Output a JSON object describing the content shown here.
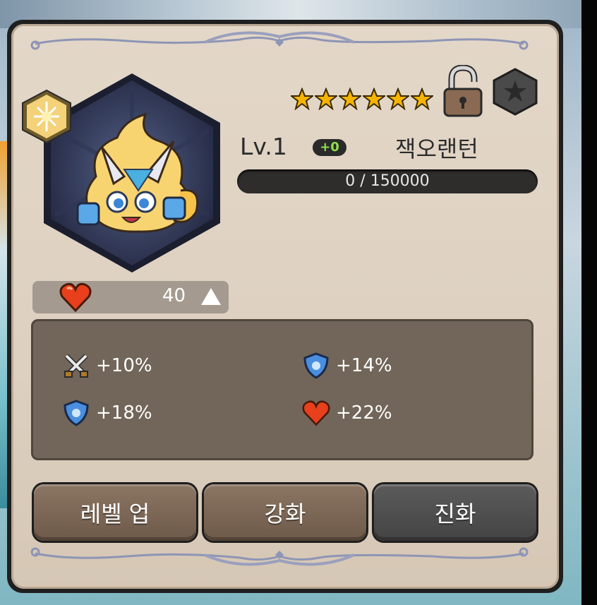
{
  "header": {
    "star_count": 6,
    "lock_state": "unlocked",
    "favorite_icon": "star-badge-icon"
  },
  "unit": {
    "level": "Lv.1",
    "enhance": "+0",
    "name": "잭오랜턴",
    "exp_text": "0 / 150000",
    "exp_fraction": 0
  },
  "hp": {
    "value": "40"
  },
  "stats": [
    {
      "icon": "crossed-swords-icon",
      "value": "+10%"
    },
    {
      "icon": "shield-icon",
      "value": "+14%"
    },
    {
      "icon": "shield-icon",
      "value": "+18%"
    },
    {
      "icon": "heart-icon",
      "value": "+22%"
    }
  ],
  "buttons": {
    "level_up": "레벨 업",
    "enhance": "강화",
    "evolve": "진화"
  },
  "colors": {
    "star": "#f5b400",
    "exp_text": "#e8e8e8",
    "enhance_badge": "#8fe14a"
  }
}
